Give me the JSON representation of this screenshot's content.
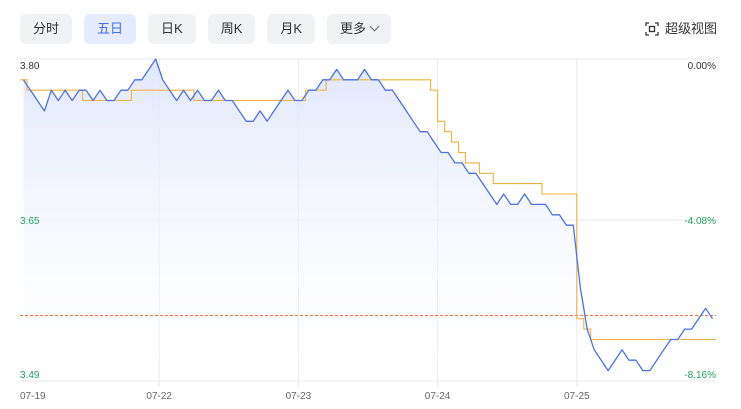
{
  "tabs": [
    {
      "label": "分时",
      "active": false
    },
    {
      "label": "五日",
      "active": true
    },
    {
      "label": "日K",
      "active": false
    },
    {
      "label": "周K",
      "active": false
    },
    {
      "label": "月K",
      "active": false
    },
    {
      "label": "更多",
      "active": false,
      "has_dropdown": true
    }
  ],
  "fullview": {
    "label": "超级视图",
    "icon": "expand-frame-icon"
  },
  "colors": {
    "price_line": "#4a72e8",
    "avg_line": "#f0b23e",
    "area_fill_top": "#dfe6fb",
    "prev_close_line": "#f06a3b",
    "rise_text": "#f04848",
    "fall_text": "#20a060",
    "neutral_text": "#333333",
    "grid": "#e6e8ee"
  },
  "chart_data": {
    "type": "line",
    "title": "",
    "xlabel": "",
    "ylabel": "",
    "x_ticks": [
      "07-19",
      "07-22",
      "07-23",
      "07-24",
      "07-25"
    ],
    "y_left_ticks": [
      {
        "value": 3.8,
        "label": "3.80"
      },
      {
        "value": 3.65,
        "label": "3.65"
      },
      {
        "value": 3.49,
        "label": "3.49"
      }
    ],
    "y_right_ticks": [
      {
        "label": "0.00%"
      },
      {
        "label": "-4.08%"
      },
      {
        "label": "-8.16%"
      }
    ],
    "ylim": [
      3.49,
      3.8
    ],
    "prev_close": 3.553,
    "grid": true,
    "series": [
      {
        "role": "price",
        "values": [
          3.78,
          3.77,
          3.76,
          3.75,
          3.77,
          3.76,
          3.77,
          3.76,
          3.77,
          3.77,
          3.76,
          3.77,
          3.76,
          3.76,
          3.77,
          3.77,
          3.78,
          3.78,
          3.79,
          3.8,
          3.78,
          3.77,
          3.76,
          3.77,
          3.76,
          3.77,
          3.76,
          3.76,
          3.77,
          3.76,
          3.76,
          3.75,
          3.74,
          3.74,
          3.75,
          3.74,
          3.75,
          3.76,
          3.77,
          3.76,
          3.76,
          3.77,
          3.77,
          3.78,
          3.78,
          3.79,
          3.78,
          3.78,
          3.78,
          3.79,
          3.78,
          3.78,
          3.77,
          3.77,
          3.76,
          3.75,
          3.74,
          3.73,
          3.73,
          3.72,
          3.71,
          3.71,
          3.7,
          3.7,
          3.69,
          3.69,
          3.68,
          3.67,
          3.66,
          3.67,
          3.66,
          3.66,
          3.67,
          3.66,
          3.66,
          3.66,
          3.65,
          3.65,
          3.64,
          3.64,
          3.58,
          3.54,
          3.52,
          3.51,
          3.5,
          3.51,
          3.52,
          3.51,
          3.51,
          3.5,
          3.5,
          3.51,
          3.52,
          3.53,
          3.53,
          3.54,
          3.54,
          3.55,
          3.56,
          3.55
        ]
      },
      {
        "role": "average",
        "values": [
          3.78,
          3.77,
          3.77,
          3.77,
          3.77,
          3.77,
          3.77,
          3.77,
          3.77,
          3.76,
          3.76,
          3.76,
          3.76,
          3.76,
          3.76,
          3.76,
          3.77,
          3.77,
          3.77,
          3.77,
          3.77,
          3.77,
          3.77,
          3.77,
          3.77,
          3.76,
          3.76,
          3.76,
          3.76,
          3.76,
          3.76,
          3.76,
          3.76,
          3.76,
          3.76,
          3.76,
          3.76,
          3.76,
          3.76,
          3.76,
          3.76,
          3.77,
          3.77,
          3.77,
          3.78,
          3.78,
          3.78,
          3.78,
          3.78,
          3.78,
          3.78,
          3.78,
          3.78,
          3.78,
          3.78,
          3.78,
          3.78,
          3.78,
          3.78,
          3.77,
          3.74,
          3.73,
          3.72,
          3.71,
          3.7,
          3.7,
          3.69,
          3.69,
          3.68,
          3.68,
          3.68,
          3.68,
          3.68,
          3.68,
          3.68,
          3.67,
          3.67,
          3.67,
          3.67,
          3.67,
          3.55,
          3.54,
          3.53,
          3.53,
          3.53,
          3.53,
          3.53,
          3.53,
          3.53,
          3.53,
          3.53,
          3.53,
          3.53,
          3.53,
          3.53,
          3.53,
          3.53,
          3.53,
          3.53,
          3.53
        ]
      }
    ]
  }
}
